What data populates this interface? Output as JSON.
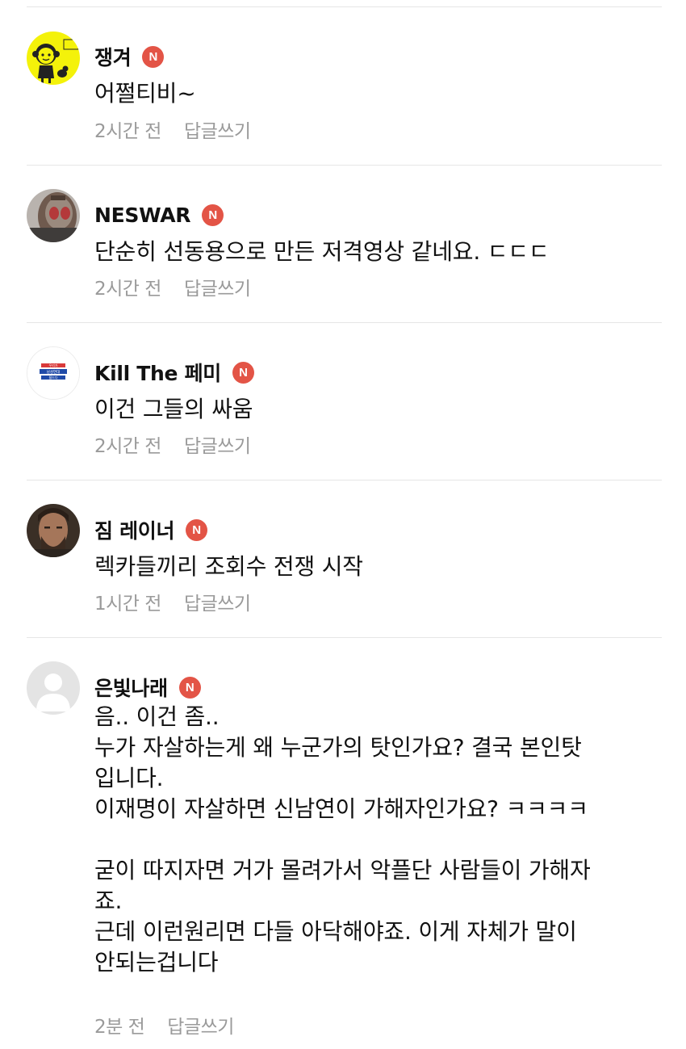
{
  "comments": [
    {
      "nickname": "쟁겨",
      "badge": "N",
      "avatar_icon": "cartoon-girl-avatar",
      "lines": [
        "어쩔티비~"
      ],
      "time": "2시간 전",
      "reply_label": "답글쓰기"
    },
    {
      "nickname": "NESWAR",
      "badge": "N",
      "avatar_icon": "masked-hero-avatar",
      "lines": [
        "단순히 선동용으로 만든 저격영상 같네요. ㄷㄷㄷ"
      ],
      "time": "2시간 전",
      "reply_label": "답글쓰기"
    },
    {
      "nickname": "Kill The 페미",
      "badge": "N",
      "avatar_icon": "text-logo-avatar",
      "avatar_text": [
        "우리가",
        "남성연대",
        "될드다"
      ],
      "lines": [
        "이건 그들의 싸움"
      ],
      "time": "2시간 전",
      "reply_label": "답글쓰기"
    },
    {
      "nickname": "짐 레이너",
      "badge": "N",
      "avatar_icon": "bearded-man-avatar",
      "lines": [
        "렉카들끼리 조회수 전쟁 시작"
      ],
      "time": "1시간 전",
      "reply_label": "답글쓰기"
    },
    {
      "nickname": "은빛나래",
      "badge": "N",
      "avatar_icon": "default-user-avatar",
      "lines": [
        "음.. 이건 좀..",
        "누가 자살하는게 왜 누군가의 탓인가요? 결국 본인탓",
        "입니다.",
        "이재명이 자살하면 신남연이 가해자인가요? ㅋㅋㅋㅋ",
        "",
        "굳이 따지자면 거가 몰려가서 악플단 사람들이 가해자",
        "죠.",
        "근데 이런원리면 다들 아닥해야죠. 이게 자체가 말이",
        "안되는겁니다"
      ],
      "time": "2분 전",
      "reply_label": "답글쓰기"
    }
  ],
  "colors": {
    "badge": "#e35446",
    "meta_text": "#9a9a9a",
    "divider": "#e6e6e6",
    "avatar_1_bg": "#f4f20a"
  }
}
